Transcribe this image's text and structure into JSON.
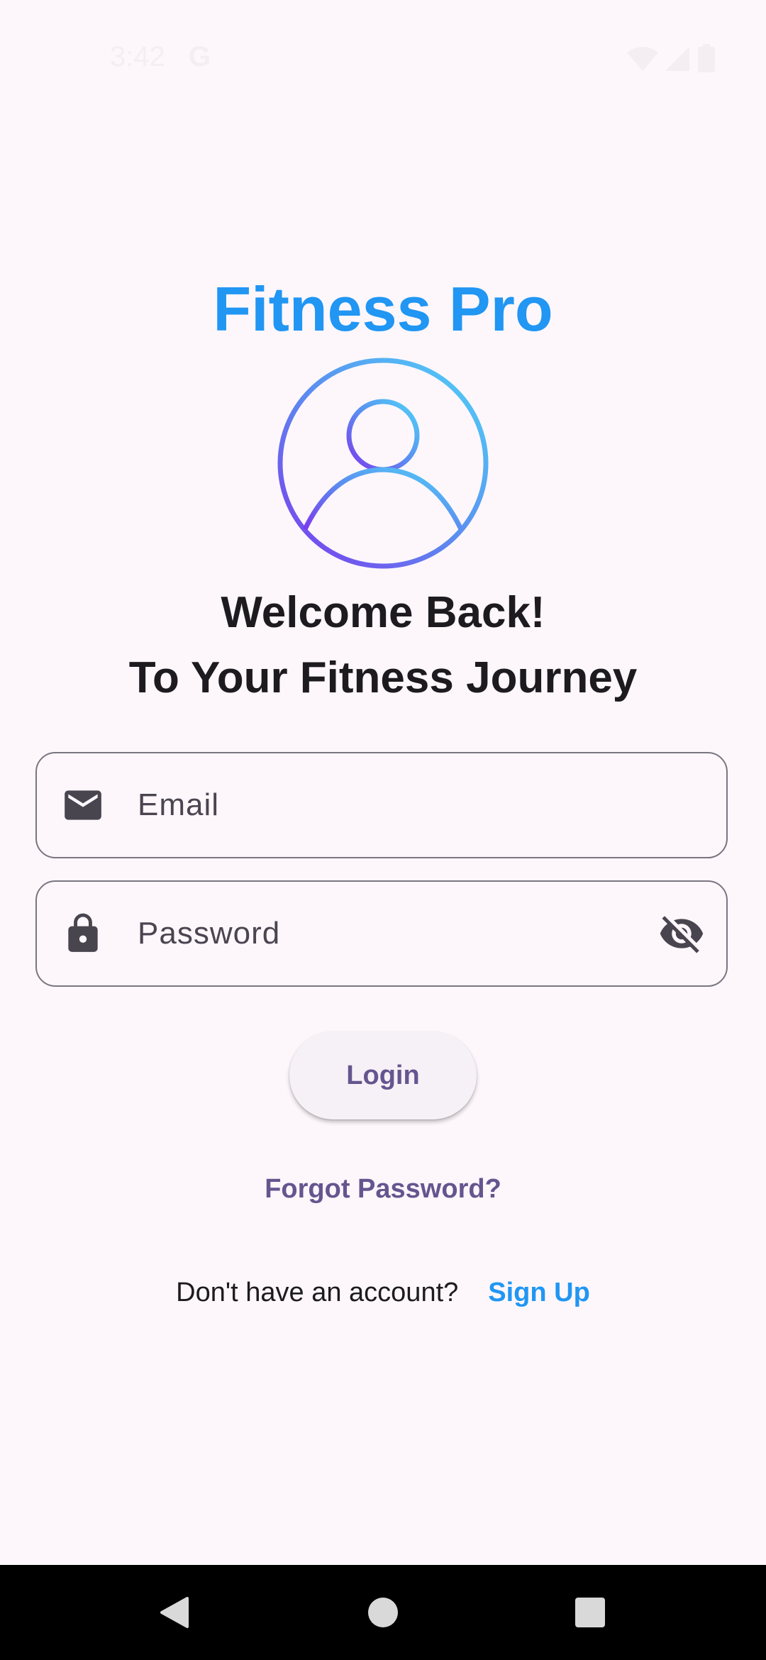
{
  "status_bar": {
    "time": "3:42",
    "notification_glyph": "G",
    "icons": [
      "wifi-icon",
      "signal-icon",
      "battery-icon"
    ]
  },
  "app": {
    "title": "Fitness Pro",
    "avatar_icon": "account-circle-icon",
    "welcome_line1": "Welcome Back!",
    "welcome_line2": "To Your Fitness Journey"
  },
  "form": {
    "email": {
      "placeholder": "Email",
      "value": "",
      "icon": "mail-icon"
    },
    "password": {
      "placeholder": "Password",
      "value": "",
      "icon": "lock-icon",
      "toggle_icon": "visibility-off-icon"
    },
    "login_label": "Login",
    "forgot_label": "Forgot Password?",
    "no_account_text": "Don't have an account?",
    "signup_label": "Sign Up"
  },
  "nav_bar": {
    "buttons": [
      "back-icon",
      "home-icon",
      "recents-icon"
    ]
  },
  "colors": {
    "background": "#fdf7fc",
    "title_blue": "#2196f3",
    "accent_purple": "#65558f",
    "gradient_start": "#7c3aed",
    "gradient_end": "#4fc3f7"
  }
}
